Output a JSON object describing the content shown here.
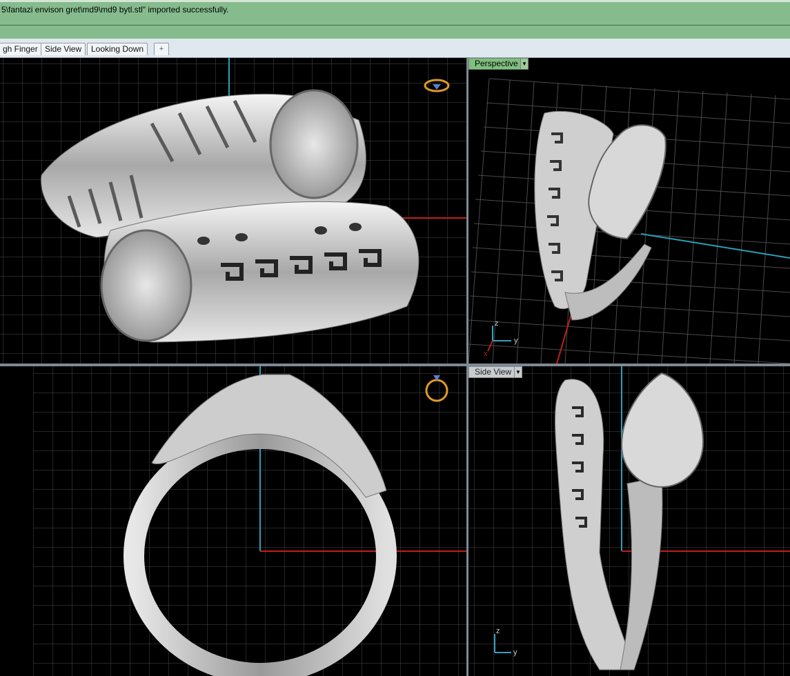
{
  "command_line": {
    "message": "5\\fantazi envison gret\\md9\\md9 bytl.stl\" imported successfully."
  },
  "tabs": [
    {
      "label": "gh Finger"
    },
    {
      "label": "Side View"
    },
    {
      "label": "Looking Down"
    },
    {
      "label": "+"
    }
  ],
  "viewports": {
    "top_left": {
      "label": ""
    },
    "top_right": {
      "label": "Perspective",
      "active": true
    },
    "bottom_left": {
      "label": ""
    },
    "bottom_right": {
      "label": "Side View",
      "active": false
    }
  },
  "axis_labels": {
    "x": "x",
    "y": "y",
    "z": "z"
  },
  "colors": {
    "command_bg": "#86bc8d",
    "viewport_bg": "#000000",
    "grid": "#505050",
    "axis_x": "#c02020",
    "axis_y": "#2aa0b8",
    "active_label": "#7fbf7f",
    "ring_metal": "#d8d8d8"
  },
  "icons": [
    "ring-gem-icon",
    "ring-side-icon",
    "dropdown-arrow-icon",
    "add-tab-icon"
  ]
}
